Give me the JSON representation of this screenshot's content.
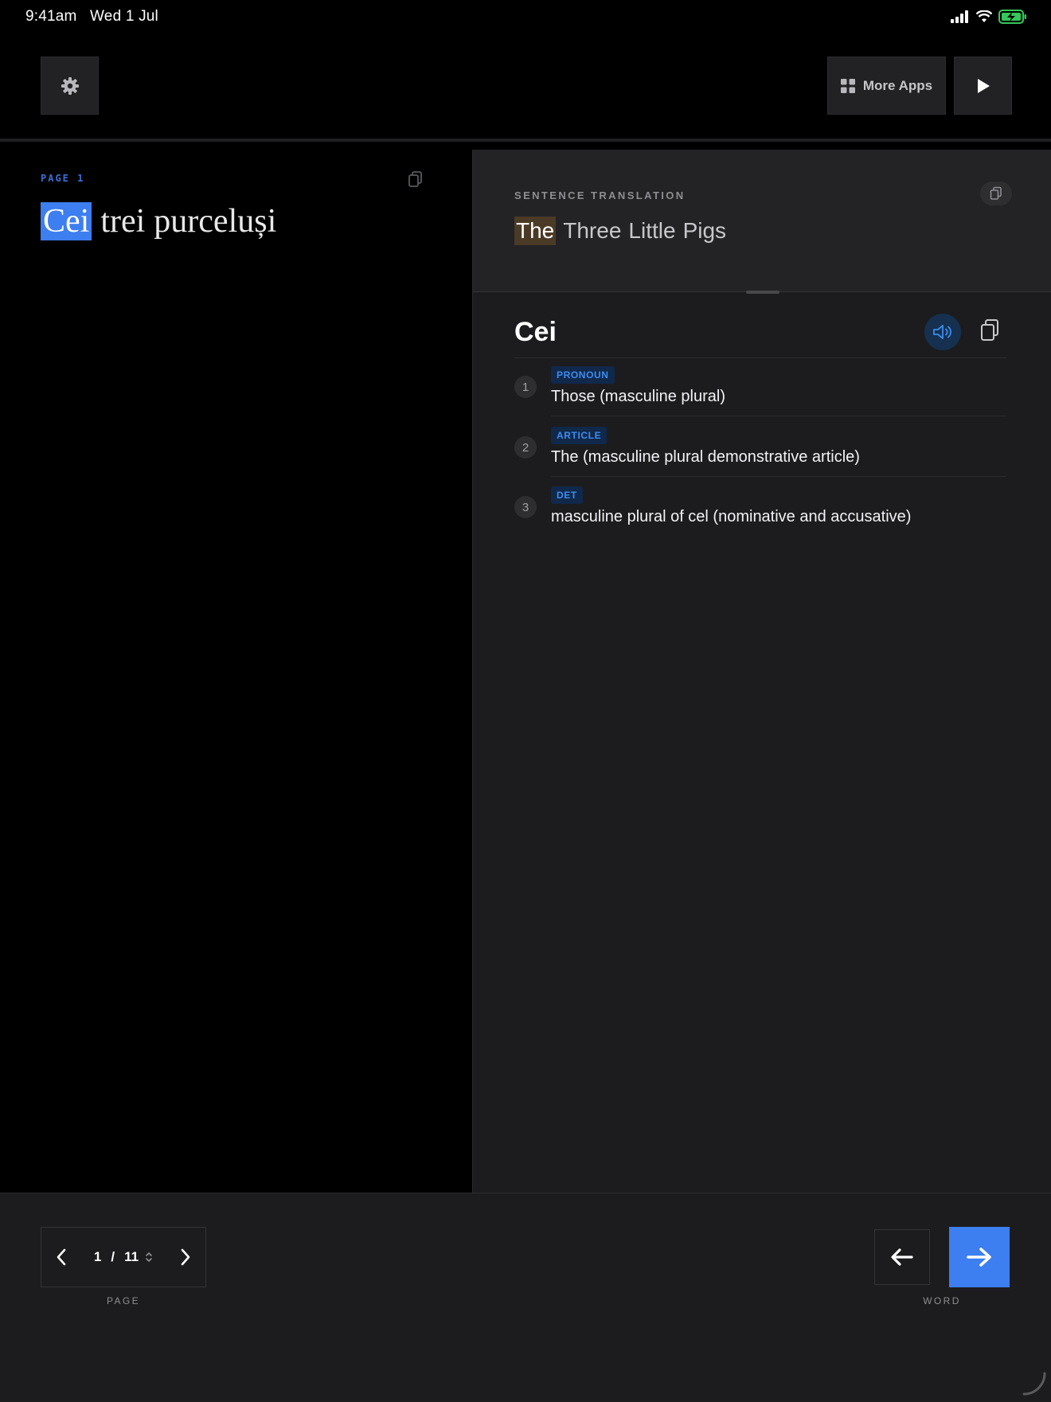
{
  "status_bar": {
    "time": "9:41am",
    "date": "Wed 1 Jul",
    "icons": [
      "signal-icon",
      "wifi-icon",
      "battery-charging-icon"
    ],
    "battery_color": "#34c759"
  },
  "toolbar": {
    "settings_icon": "gear-icon",
    "more_apps_label": "More Apps",
    "more_apps_icon": "grid-icon",
    "play_icon": "play-icon"
  },
  "source": {
    "page_label": "PAGE 1",
    "words": [
      "Cei",
      "trei",
      "purceluși"
    ],
    "highlighted_index": 0,
    "highlight_color": "#3d7ef0"
  },
  "translation": {
    "label": "SENTENCE TRANSLATION",
    "words": [
      "The",
      "Three",
      "Little",
      "Pigs"
    ],
    "highlighted_index": 0,
    "highlight_color": "#4b3a26"
  },
  "dictionary": {
    "word": "Cei",
    "definitions": [
      {
        "num": "1",
        "pos": "PRONOUN",
        "text": "Those (masculine plural)"
      },
      {
        "num": "2",
        "pos": "ARTICLE",
        "text": "The (masculine plural demonstrative article)"
      },
      {
        "num": "3",
        "pos": "DET",
        "text": "masculine plural of cel (nominative and accusative)"
      }
    ],
    "accent_color": "#3d8cf0"
  },
  "pager": {
    "current": "1",
    "separator": "/",
    "total": "11",
    "caption": "PAGE"
  },
  "word_nav": {
    "caption": "WORD",
    "accent_color": "#3d7ef0"
  }
}
